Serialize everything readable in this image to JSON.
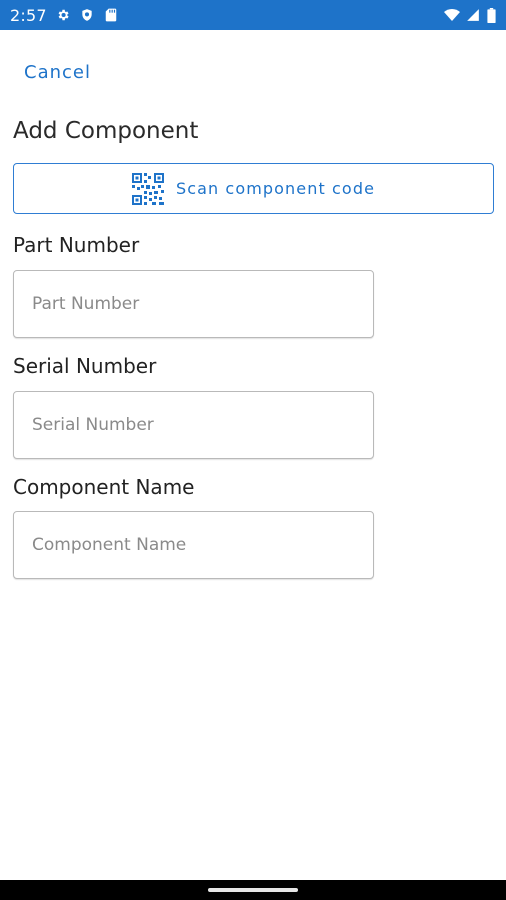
{
  "status_bar": {
    "time": "2:57",
    "bg_color": "#1e73c9",
    "left_icons": [
      "gear-icon",
      "shield-icon",
      "sd-card-icon"
    ],
    "right_icons": [
      "wifi-icon",
      "cell-signal-icon",
      "battery-icon"
    ]
  },
  "header": {
    "cancel_label": "Cancel",
    "title": "Add Component"
  },
  "scan": {
    "label": "Scan component code",
    "icon": "qr-code-icon",
    "accent_color": "#1e73c9"
  },
  "form": {
    "part_number": {
      "label": "Part Number",
      "value": "",
      "placeholder": "Part Number"
    },
    "serial_number": {
      "label": "Serial Number",
      "value": "",
      "placeholder": "Serial Number"
    },
    "component_name": {
      "label": "Component Name",
      "value": "",
      "placeholder": "Component Name"
    }
  }
}
